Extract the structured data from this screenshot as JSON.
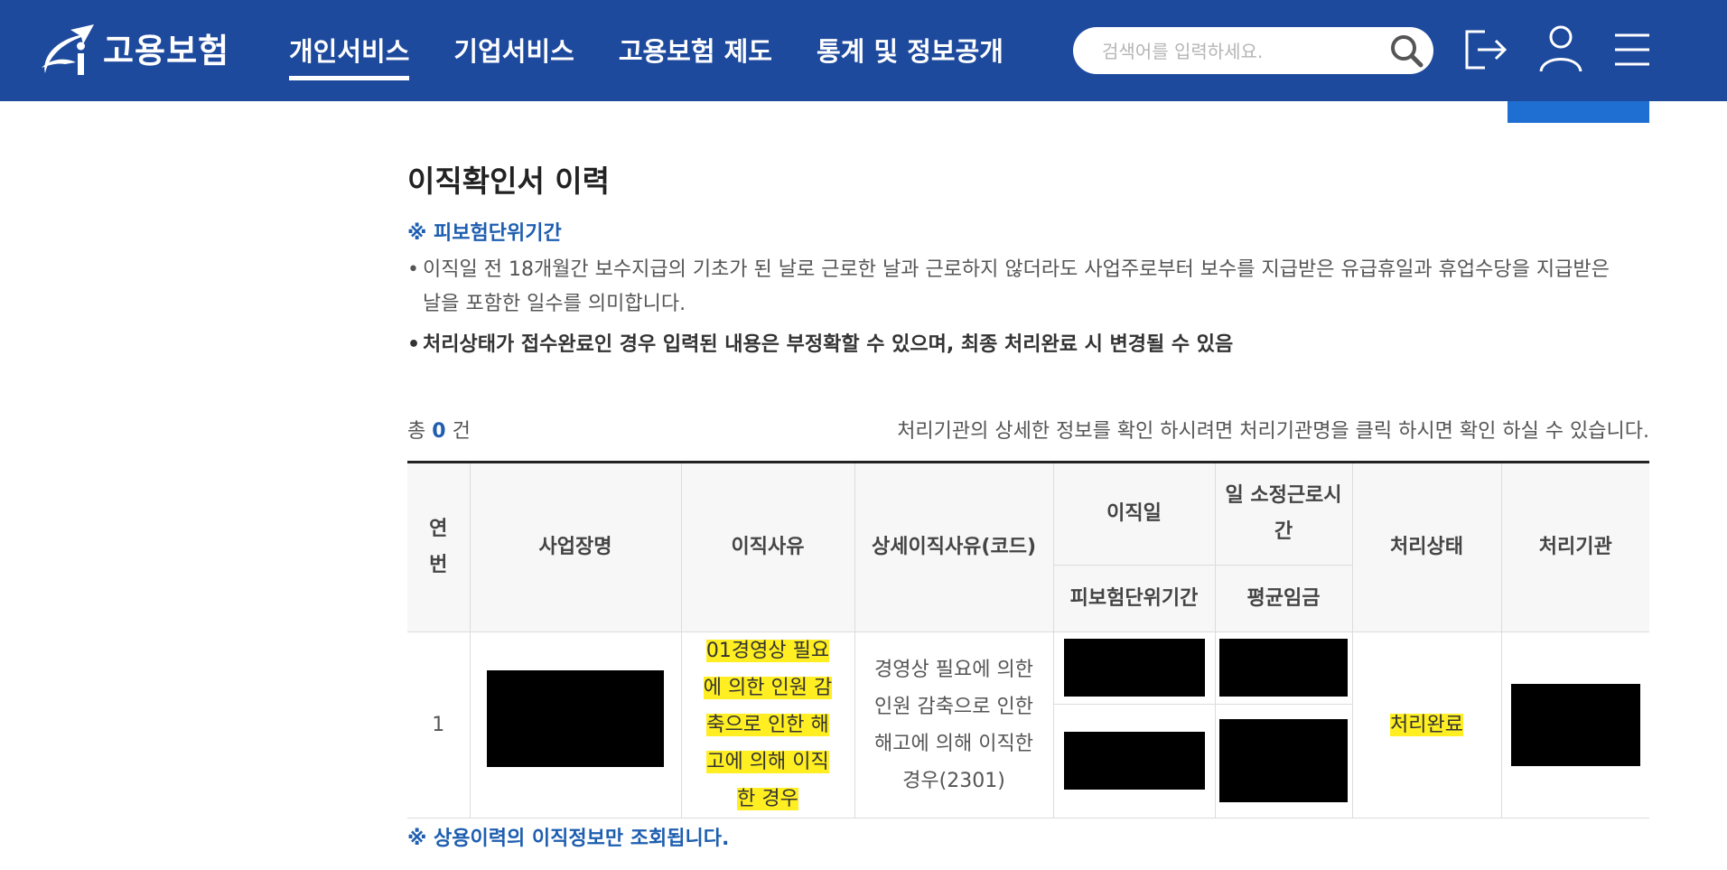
{
  "header": {
    "logo_text": "고용보험",
    "nav": [
      {
        "label": "개인서비스",
        "active": true
      },
      {
        "label": "기업서비스",
        "active": false
      },
      {
        "label": "고용보험 제도",
        "active": false
      },
      {
        "label": "통계 및 정보공개",
        "active": false
      }
    ],
    "search_placeholder": "검색어를 입력하세요.",
    "icons": [
      "search-icon",
      "logout-icon",
      "user-icon",
      "menu-icon"
    ],
    "color": "#1e4a9e"
  },
  "page": {
    "title": "이직확인서 이력",
    "note_head": "※ 피보험단위기간",
    "bullet1": "이직일 전 18개월간 보수지급의 기초가 된 날로 근로한 날과 근로하지 않더라도 사업주로부터 보수를 지급받은 유급휴일과 휴업수당을 지급받은 날을 포함한 일수를 의미합니다.",
    "bullet2": "처리상태가 접수완료인 경우 입력된 내용은 부정확할 수 있으며, 최종 처리완료 시 변경될 수 있음",
    "total_prefix": "총",
    "total_count": "0",
    "total_suffix": "건",
    "info": "처리기관의 상세한 정보를 확인 하시려면 처리기관명을 클릭 하시면 확인 하실 수 있습니다.",
    "bottom_note": "※ 상용이력의 이직정보만 조회됩니다."
  },
  "table": {
    "headers": {
      "no": "연번",
      "company": "사업장명",
      "reason": "이직사유",
      "detail": "상세이직사유(코드)",
      "leave_date": "이직일",
      "work_hours": "일 소정근로시간",
      "insured_period": "피보험단위기간",
      "avg_wage": "평균임금",
      "status": "처리상태",
      "agency": "처리기관"
    },
    "rows": [
      {
        "no": "1",
        "reason": "01경영상 필요에 의한 인원 감축으로 인한 해고에 의해 이직한 경우",
        "detail": "경영상 필요에 의한 인원 감축으로 인한 해고에 의해 이직한 경우(2301)",
        "status": "처리완료"
      }
    ]
  }
}
